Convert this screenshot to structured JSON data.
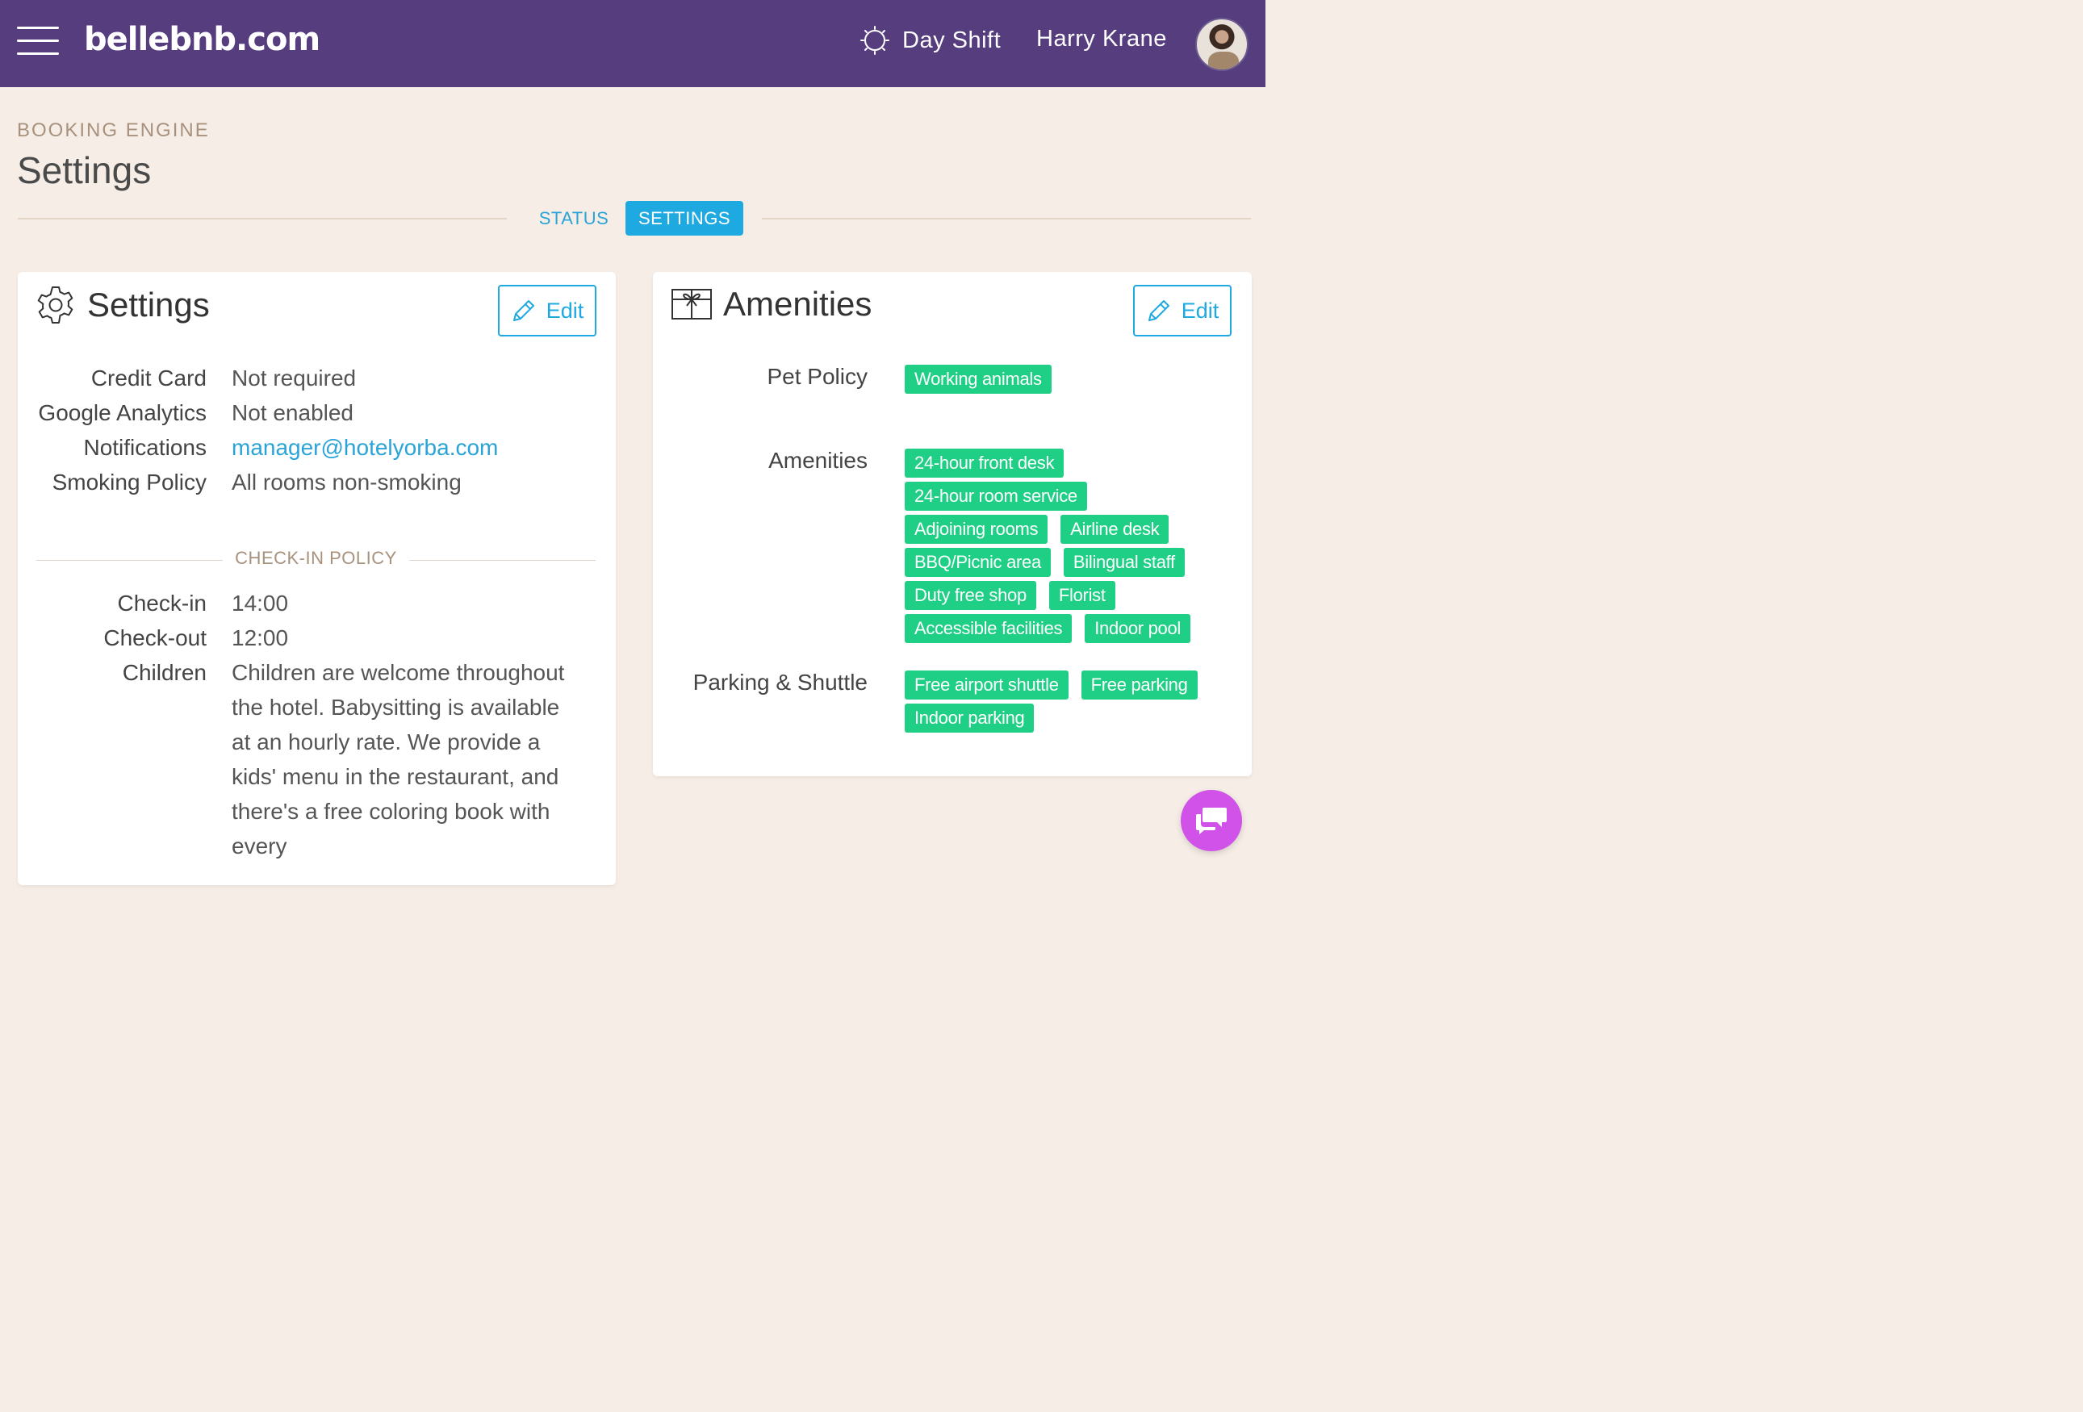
{
  "header": {
    "brand": "bellebnb.com",
    "shift_label": "Day Shift",
    "user_name": "Harry Krane"
  },
  "page": {
    "eyebrow": "BOOKING ENGINE",
    "title": "Settings"
  },
  "tabs": [
    {
      "label": "STATUS",
      "active": false
    },
    {
      "label": "SETTINGS",
      "active": true
    }
  ],
  "settings_card": {
    "title": "Settings",
    "edit_label": "Edit",
    "fields": [
      {
        "label": "Credit Card",
        "value": "Not required"
      },
      {
        "label": "Google Analytics",
        "value": "Not enabled"
      },
      {
        "label": "Notifications",
        "value": "manager@hotelyorba.com"
      },
      {
        "label": "Smoking Policy",
        "value": "All rooms non-smoking"
      }
    ],
    "checkin_section_title": "CHECK-IN POLICY",
    "checkin_fields": [
      {
        "label": "Check-in",
        "value": "14:00"
      },
      {
        "label": "Check-out",
        "value": "12:00"
      },
      {
        "label": "Children",
        "value": "Children are welcome throughout the hotel. Babysitting is available at an hourly rate. We provide a kids' menu in the restaurant, and there's a free coloring book with every"
      }
    ]
  },
  "amenities_card": {
    "title": "Amenities",
    "edit_label": "Edit",
    "groups": [
      {
        "label": "Pet Policy",
        "tags": [
          "Working animals"
        ]
      },
      {
        "label": "Amenities",
        "tags": [
          "24-hour front desk",
          "24-hour room service",
          "Adjoining rooms",
          "Airline desk",
          "BBQ/Picnic area",
          "Bilingual staff",
          "Duty free shop",
          "Florist",
          "Accessible facilities",
          "Indoor pool"
        ]
      },
      {
        "label": "Parking & Shuttle",
        "tags": [
          "Free airport shuttle",
          "Free parking",
          "Indoor parking"
        ]
      }
    ]
  },
  "colors": {
    "header_bg": "#553d7e",
    "page_bg": "#f6ede6",
    "accent": "#1fa9e1",
    "tag": "#1fcf85",
    "chat": "#d052e8"
  }
}
